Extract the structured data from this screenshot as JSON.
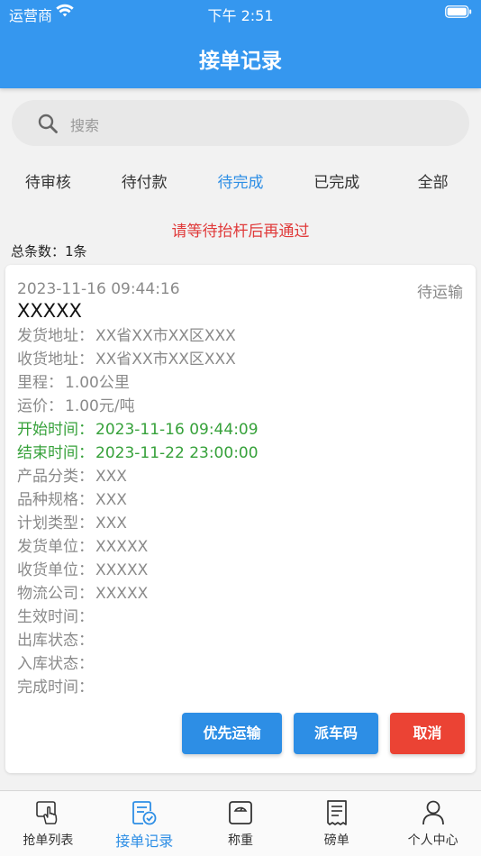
{
  "status_bar": {
    "carrier": "运营商",
    "time": "下午 2:51"
  },
  "nav": {
    "title": "接单记录"
  },
  "search": {
    "placeholder": "搜索",
    "icon": "search-icon"
  },
  "tabs": [
    {
      "label": "待审核",
      "active": false
    },
    {
      "label": "待付款",
      "active": false
    },
    {
      "label": "待完成",
      "active": true
    },
    {
      "label": "已完成",
      "active": false
    },
    {
      "label": "全部",
      "active": false
    }
  ],
  "notice": "请等待抬杆后再通过",
  "total": "总条数：1条",
  "order": {
    "time": "2023-11-16 09:44:16",
    "status": "待运输",
    "title": "XXXXX",
    "fields": [
      {
        "label": "发货地址：",
        "value": "XX省XX市XX区XXX"
      },
      {
        "label": "收货地址：",
        "value": "XX省XX市XX区XXX"
      },
      {
        "label": "里程：",
        "value": "1.00公里"
      },
      {
        "label": "运价：",
        "value": "1.00元/吨"
      },
      {
        "label": "开始时间：",
        "value": "2023-11-16 09:44:09"
      },
      {
        "label": "结束时间：",
        "value": "2023-11-22 23:00:00"
      },
      {
        "label": "产品分类：",
        "value": "XXX"
      },
      {
        "label": "品种规格：",
        "value": "XXX"
      },
      {
        "label": "计划类型：",
        "value": "XXX"
      },
      {
        "label": "发货单位：",
        "value": "XXXXX"
      },
      {
        "label": "收货单位：",
        "value": "XXXXX"
      },
      {
        "label": "物流公司：",
        "value": "XXXXX"
      },
      {
        "label": "生效时间：",
        "value": ""
      },
      {
        "label": "出库状态：",
        "value": ""
      },
      {
        "label": "入库状态：",
        "value": ""
      },
      {
        "label": "完成时间：",
        "value": ""
      }
    ],
    "buttons": {
      "priority": "优先运输",
      "dispatch": "派车码",
      "cancel": "取消"
    }
  },
  "tabbar": [
    {
      "label": "抢单列表",
      "icon": "hand-pointer-icon",
      "active": false
    },
    {
      "label": "接单记录",
      "icon": "document-check-icon",
      "active": true
    },
    {
      "label": "称重",
      "icon": "scale-icon",
      "active": false
    },
    {
      "label": "磅单",
      "icon": "receipt-icon",
      "active": false
    },
    {
      "label": "个人中心",
      "icon": "user-icon",
      "active": false
    }
  ],
  "colors": {
    "primary": "#3597ef",
    "accent": "#2d8ee5",
    "danger": "#eb4334",
    "success": "#36a13a",
    "notice": "#e03a3a"
  }
}
